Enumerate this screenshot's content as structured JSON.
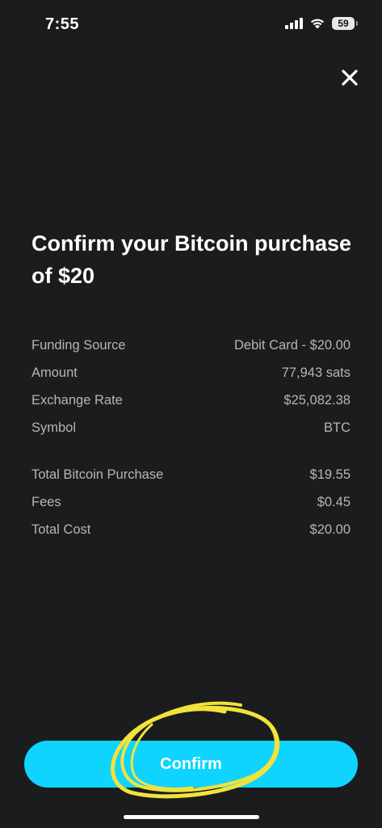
{
  "status_bar": {
    "time": "7:55",
    "battery": "59",
    "icons": [
      "signal-icon",
      "wifi-icon",
      "battery-icon"
    ]
  },
  "header": {
    "close_icon": "close-icon"
  },
  "title": "Confirm your Bitcoin purchase of $20",
  "details": [
    {
      "label": "Funding Source",
      "value": "Debit Card - $20.00"
    },
    {
      "label": "Amount",
      "value": "77,943 sats"
    },
    {
      "label": "Exchange Rate",
      "value": "$25,082.38"
    },
    {
      "label": "Symbol",
      "value": "BTC"
    }
  ],
  "totals": [
    {
      "label": "Total Bitcoin Purchase",
      "value": "$19.55"
    },
    {
      "label": "Fees",
      "value": "$0.45"
    },
    {
      "label": "Total Cost",
      "value": "$20.00"
    }
  ],
  "confirm_button": {
    "label": "Confirm"
  },
  "colors": {
    "background": "#1b1c1e",
    "accent": "#0fd4ff",
    "annotation": "#f2e33a",
    "label_text": "#b5b5b7"
  }
}
